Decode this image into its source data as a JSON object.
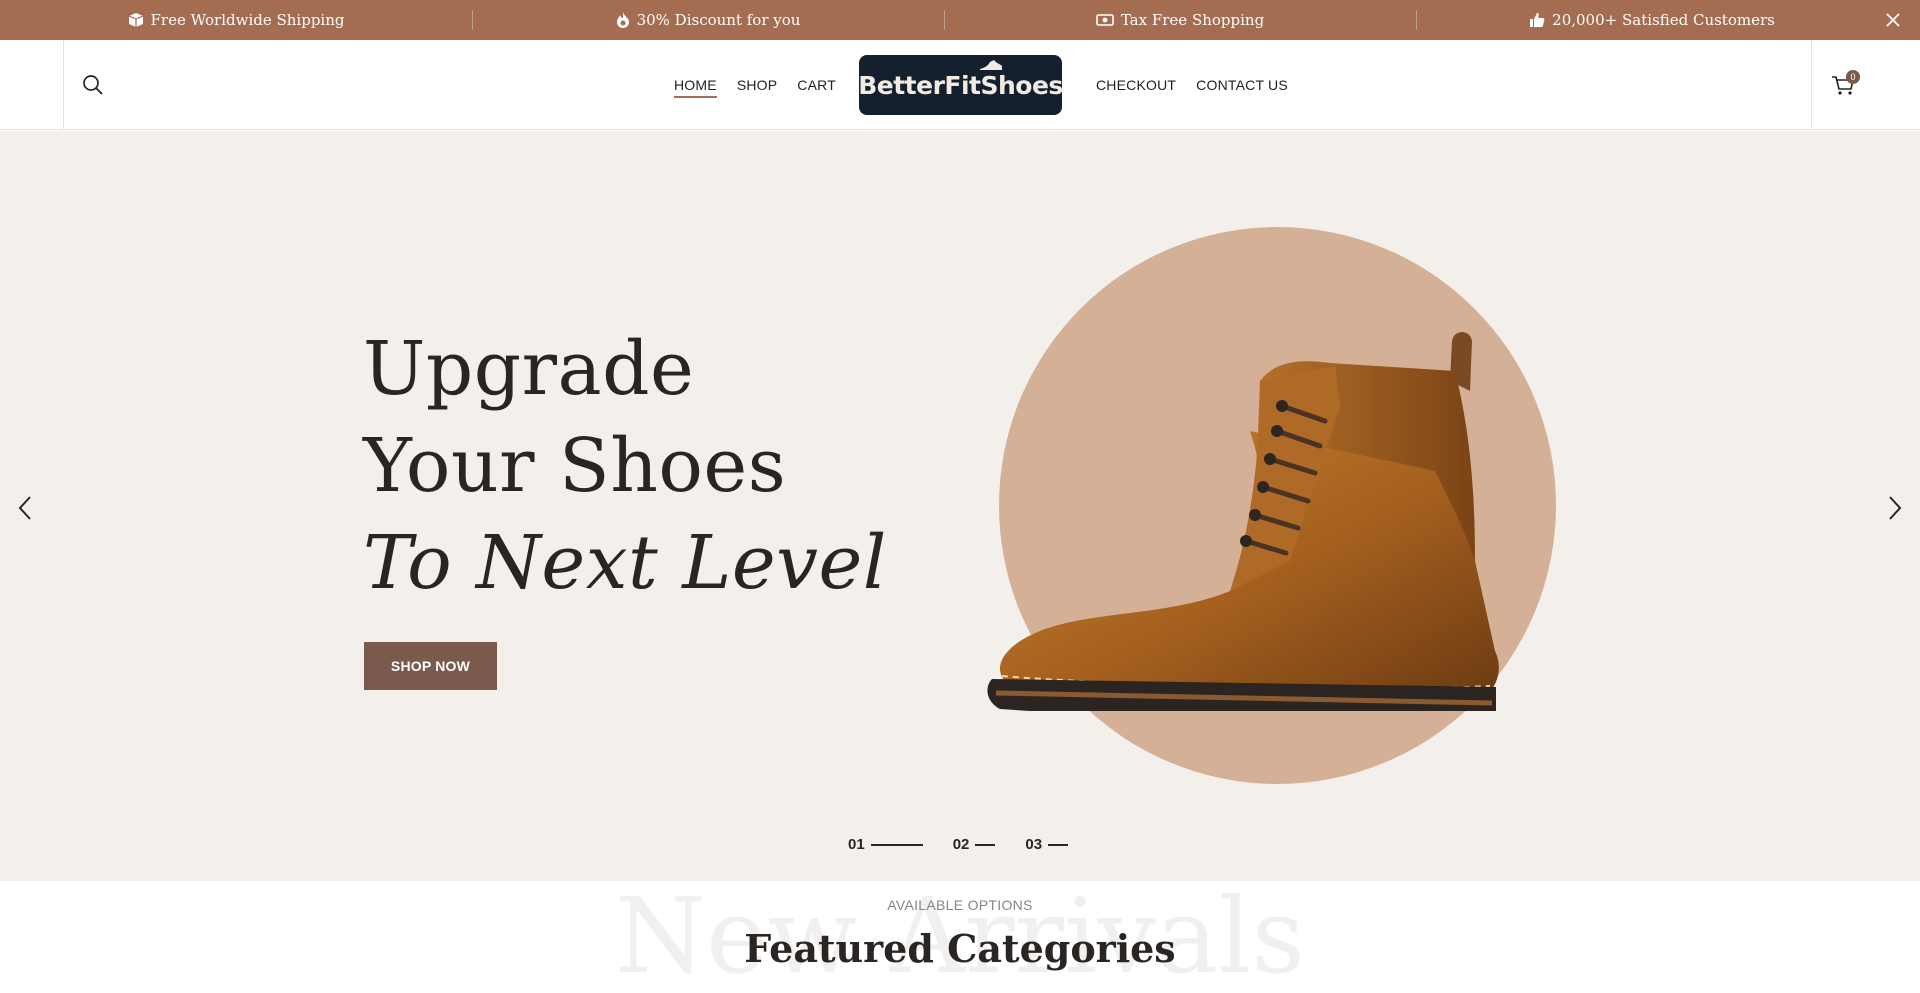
{
  "topbar": {
    "items": [
      {
        "icon": "box-icon",
        "label": "Free Worldwide Shipping"
      },
      {
        "icon": "flame-icon",
        "label": "30% Discount for you"
      },
      {
        "icon": "money-icon",
        "label": "Tax Free Shopping"
      },
      {
        "icon": "thumbs-up-icon",
        "label": "20,000+ Satisfied Customers"
      }
    ],
    "background": "#a46d52"
  },
  "header": {
    "nav_left": [
      "HOME",
      "SHOP",
      "CART"
    ],
    "nav_right": [
      "CHECKOUT",
      "CONTACT US"
    ],
    "active": "HOME",
    "logo_text": "BetterFitShoes",
    "cart_count": "0"
  },
  "hero": {
    "line1": "Upgrade",
    "line2": "Your Shoes",
    "line3": "To Next Level",
    "cta": "SHOP NOW",
    "slides": [
      "01",
      "02",
      "03"
    ],
    "active_slide": "01",
    "circle_color": "#d4b097",
    "background": "#f3efea"
  },
  "featured": {
    "background_word": "New Arrivals",
    "kicker": "AVAILABLE OPTIONS",
    "title": "Featured Categories"
  }
}
